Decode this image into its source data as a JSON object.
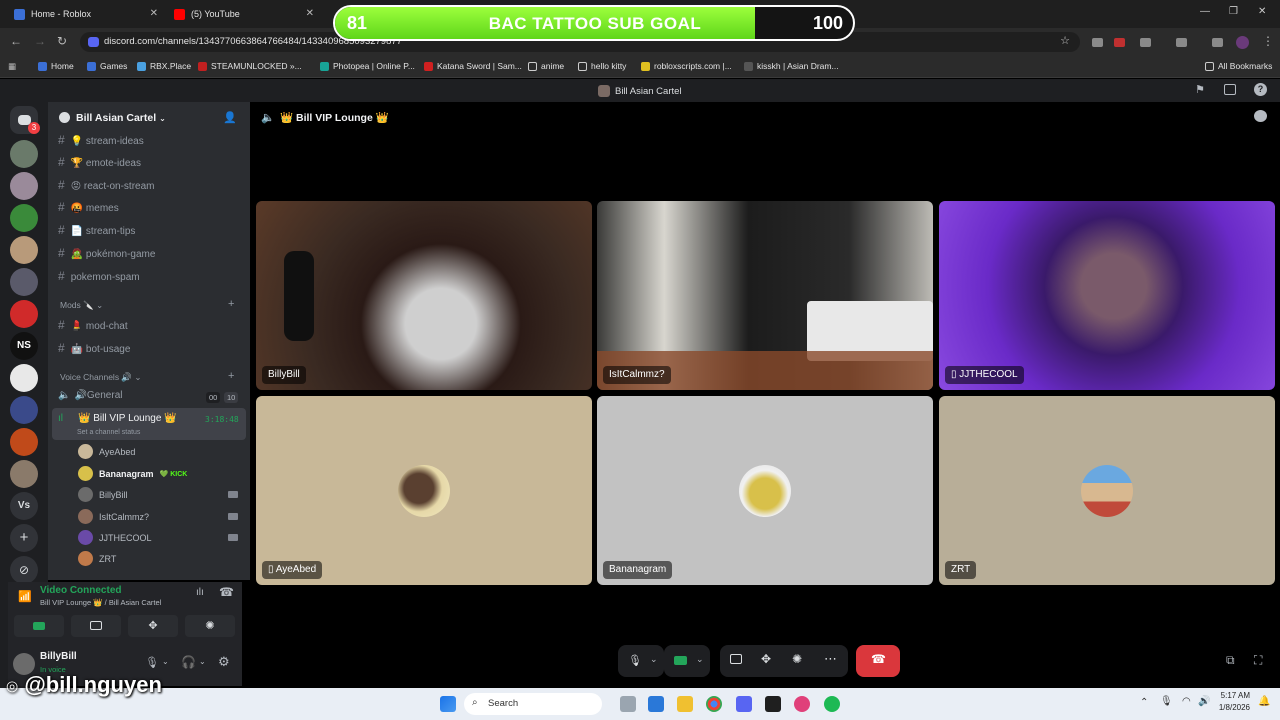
{
  "browser": {
    "tabs": [
      {
        "label": "Home - Roblox"
      },
      {
        "label": "(5) YouTube"
      }
    ],
    "url": "discord.com/channels/1343770663864766484/1433409685093279877",
    "bookmarks": [
      "Home",
      "Games",
      "RBX.Place",
      "STEAMUNLOCKED »...",
      "Photopea | Online P...",
      "Katana Sword | Sam...",
      "anime",
      "hello kitty",
      "robloxscripts.com |...",
      "kisskh | Asian Dram...",
      "All Bookmarks"
    ]
  },
  "overlay": {
    "goal_title": "BAC TATTOO SUB GOAL",
    "current": "81",
    "target": "100",
    "progress_fraction": 0.81,
    "handle": "@bill.nguyen"
  },
  "discord": {
    "window_title": "Bill Asian Cartel",
    "server_name": "Bill Asian Cartel",
    "guild_badge": "3",
    "channels": [
      {
        "name": "stream-ideas",
        "emoji": "💡"
      },
      {
        "name": "emote-ideas",
        "emoji": "🏆"
      },
      {
        "name": "react-on-stream",
        "emoji": "😡"
      },
      {
        "name": "memes",
        "emoji": "🤬"
      },
      {
        "name": "stream-tips",
        "emoji": "📄"
      },
      {
        "name": "pokémon-game",
        "emoji": "🧟"
      },
      {
        "name": "pokemon-spam",
        "emoji": ""
      }
    ],
    "mods_category": "Mods 🔪",
    "mod_channels": [
      {
        "name": "mod-chat",
        "emoji": "💄"
      },
      {
        "name": "bot-usage",
        "emoji": "🤖"
      }
    ],
    "voice_category": "Voice Channels 🔊",
    "voice_channels": [
      {
        "name": "General",
        "emoji": "🔊",
        "count_a": "00",
        "count_b": "10"
      },
      {
        "name": "Bill VIP Lounge",
        "emoji": "👑",
        "timer": "3:18:48",
        "status": "Set a channel status"
      }
    ],
    "voice_members": [
      {
        "name": "AyeAbed",
        "color": "#c9b89a",
        "tag": ""
      },
      {
        "name": "Bananagram",
        "color": "#d8c04a",
        "tag": "KICK"
      },
      {
        "name": "BillyBill",
        "color": "#6b6b6b",
        "tag": ""
      },
      {
        "name": "IsItCalmmz?",
        "color": "#8a6a5a",
        "tag": ""
      },
      {
        "name": "JJTHECOOL",
        "color": "#6a4aa8",
        "tag": ""
      },
      {
        "name": "ZRT",
        "color": "#c07a4a",
        "tag": ""
      }
    ],
    "rtc": {
      "status": "Video Connected",
      "location": "Bill VIP Lounge 👑 / Bill Asian Cartel"
    },
    "user": {
      "name": "BillyBill",
      "status": "In voice"
    },
    "call_header": "👑 Bill VIP Lounge 👑",
    "participants": [
      {
        "name": "BillyBill",
        "kind": "video",
        "bg": "#3a2a22",
        "mobile": false
      },
      {
        "name": "IsItCalmmz?",
        "kind": "video",
        "bg": "#6a6a66",
        "mobile": false
      },
      {
        "name": "JJTHECOOL",
        "kind": "video",
        "bg": "#5a2ab0",
        "mobile": true
      },
      {
        "name": "AyeAbed",
        "kind": "avatar",
        "bg": "#c8b898",
        "avatar": "#6a5a4a",
        "mobile": true
      },
      {
        "name": "Bananagram",
        "kind": "avatar",
        "bg": "#c2c2c2",
        "avatar": "#d8c04a",
        "mobile": false
      },
      {
        "name": "ZRT",
        "kind": "avatar",
        "bg": "#b8ae98",
        "avatar": "#c04a3a",
        "mobile": false
      }
    ]
  },
  "taskbar": {
    "search_placeholder": "Search",
    "time": "5:17 AM",
    "date": "1/8/2026"
  }
}
